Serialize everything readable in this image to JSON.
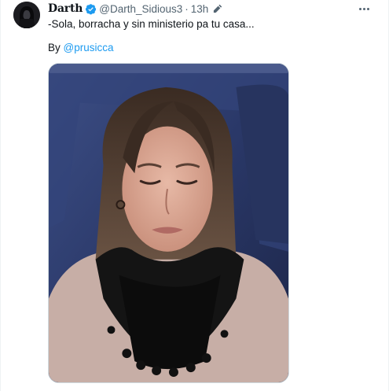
{
  "tweet": {
    "author": {
      "display_name": "Darth",
      "handle": "@Darth_Sidious3",
      "verified": true,
      "avatar_icon": "hooded-figure-avatar"
    },
    "timestamp": "13h",
    "edited_icon": "pencil-edit-icon",
    "text": "-Sola, borracha y sin ministerio pa tu casa...",
    "credit_prefix": "By ",
    "credit_mention": "@prusicca",
    "media": {
      "type": "photo",
      "icon": "photo-media"
    },
    "more_icon": "more-horizontal-icon"
  },
  "colors": {
    "accent": "#1d9bf0",
    "secondary_text": "#536471",
    "primary_text": "#0f1419",
    "border": "#cfd9de"
  }
}
